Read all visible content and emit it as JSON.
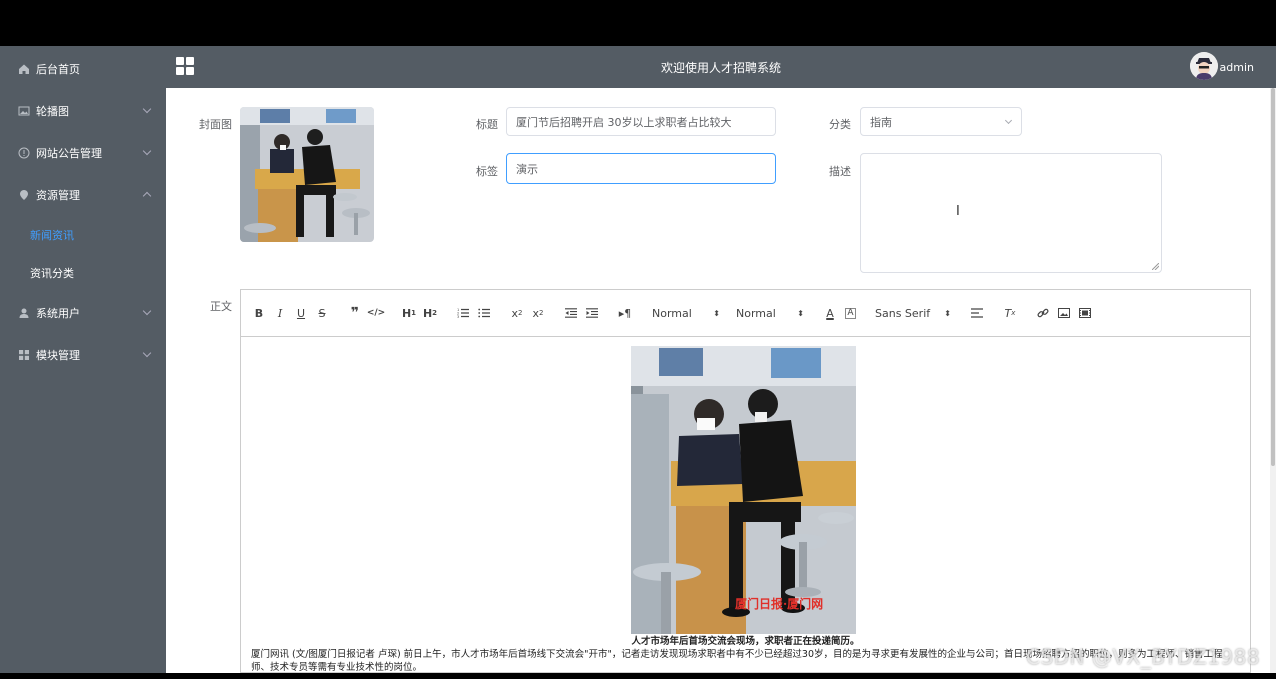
{
  "header": {
    "title": "欢迎使用人才招聘系统",
    "username": "admin"
  },
  "sidebar": {
    "items": [
      {
        "label": "后台首页",
        "icon": "home-icon"
      },
      {
        "label": "轮播图",
        "icon": "image-icon"
      },
      {
        "label": "网站公告管理",
        "icon": "info-icon"
      },
      {
        "label": "资源管理",
        "icon": "location-icon"
      },
      {
        "label": "系统用户",
        "icon": "user-icon"
      },
      {
        "label": "模块管理",
        "icon": "grid-icon"
      }
    ],
    "sub_items": [
      {
        "label": "新闻资讯",
        "active": true
      },
      {
        "label": "资讯分类",
        "active": false
      }
    ]
  },
  "form": {
    "cover_label": "封面图",
    "title_label": "标题",
    "title_value": "厦门节后招聘开启 30岁以上求职者占比较大",
    "category_label": "分类",
    "category_value": "指南",
    "tag_label": "标签",
    "tag_value": "演示",
    "desc_label": "描述",
    "body_label": "正文"
  },
  "editor": {
    "toolbar": {
      "header_select": "Normal",
      "size_select": "Normal",
      "font_select": "Sans Serif"
    },
    "image_watermark": "厦门日报·厦门网",
    "caption": "人才市场年后首场交流会现场，求职者正在投递简历。",
    "body_text": "厦门网讯 (文/图厦门日报记者 卢琛) 前日上午，市人才市场年后首场线下交流会\"开市\"，记者走访发现现场求职者中有不少已经超过30岁，目的是为寻求更有发展性的企业与公司；首日现场招聘方招的职位，则多为工程师、销售工程师、技术专员等需有专业技术性的岗位。"
  },
  "overlay": {
    "watermark": "CSDN @VX_BYDZ1988"
  },
  "colors": {
    "sidebar_bg": "#545c64",
    "accent": "#409eff"
  }
}
